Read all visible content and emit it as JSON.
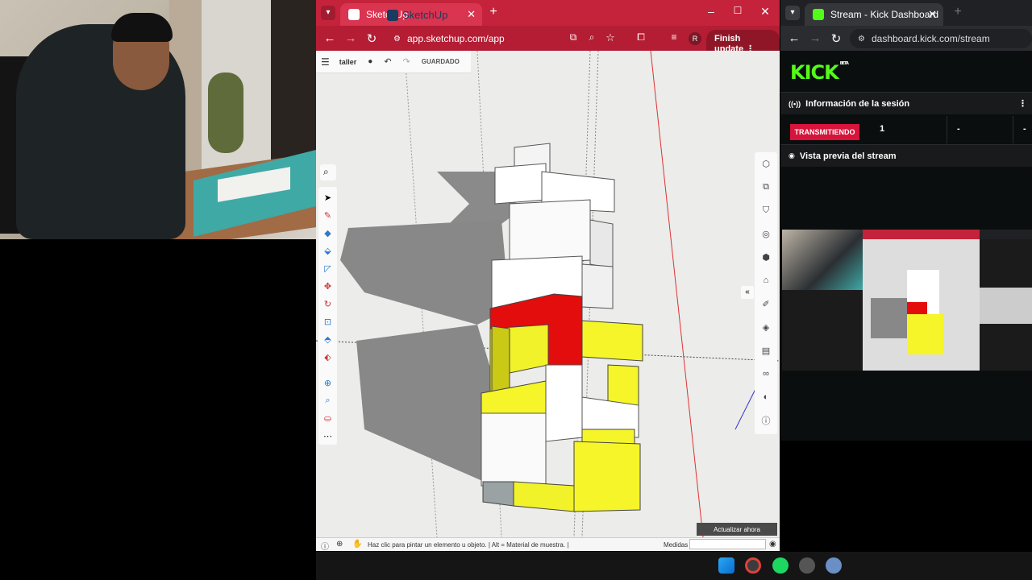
{
  "sketchup_window": {
    "tab_title": "SketchUp",
    "url": "app.sketchup.com/app",
    "profile_initial": "R",
    "finish_update_label": "Finish update",
    "toolbar": {
      "project_name": "taller",
      "saved_label": "GUARDADO"
    },
    "logo_text": "SketchUp",
    "update_now_label": "Actualizar ahora",
    "status_text": "Haz clic para pintar un elemento u objeto. | Alt = Material de muestra. |",
    "measures_label": "Medidas",
    "left_tools": [
      "search-tool",
      "select-tool",
      "pencil-tool",
      "eraser-tool",
      "paint-tool",
      "tape-tool",
      "move-tool",
      "rotate-tool",
      "scale-tool",
      "pushpull-tool",
      "paint-bucket-tool",
      "orbit-tool",
      "zoom-tool",
      "walk-tool",
      "more-tools"
    ],
    "right_tools": [
      "entity-info",
      "components",
      "materials",
      "styles",
      "views",
      "scenes",
      "layers",
      "shadows",
      "display",
      "instructor",
      "glasses",
      "solar",
      "info"
    ]
  },
  "kick_window": {
    "tab_title": "Stream - Kick Dashboard",
    "url": "dashboard.kick.com/stream",
    "logo": "KICK",
    "logo_badge": "BETA",
    "session_info_label": "Información de la sesión",
    "live_badge": "TRANSMITIENDO",
    "viewer_count": "1",
    "stat_2": "-",
    "stat_3": "-",
    "preview_label": "Vista previa del stream"
  },
  "colors": {
    "chrome_red": "#c5233b",
    "kick_green": "#53fc18",
    "live_red": "#d7143b",
    "model_yellow": "#f5f52a",
    "model_red": "#e30d0d"
  }
}
